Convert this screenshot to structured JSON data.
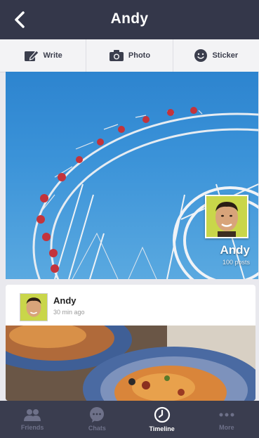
{
  "header": {
    "title": "Andy"
  },
  "actions": [
    {
      "label": "Write",
      "icon": "write-icon"
    },
    {
      "label": "Photo",
      "icon": "camera-icon"
    },
    {
      "label": "Sticker",
      "icon": "sticker-icon"
    }
  ],
  "cover": {
    "name": "Andy",
    "posts": "100 posts"
  },
  "post": {
    "author": "Andy",
    "time": "30 min ago"
  },
  "tabs": [
    {
      "label": "Friends",
      "icon": "friends-icon"
    },
    {
      "label": "Chats",
      "icon": "chats-icon"
    },
    {
      "label": "Timeline",
      "icon": "timeline-icon",
      "active": true
    },
    {
      "label": "More",
      "icon": "more-icon"
    }
  ],
  "colors": {
    "header_bg": "#34374a",
    "tabbar_bg": "#3a3d4f",
    "accent_white": "#ffffff"
  }
}
